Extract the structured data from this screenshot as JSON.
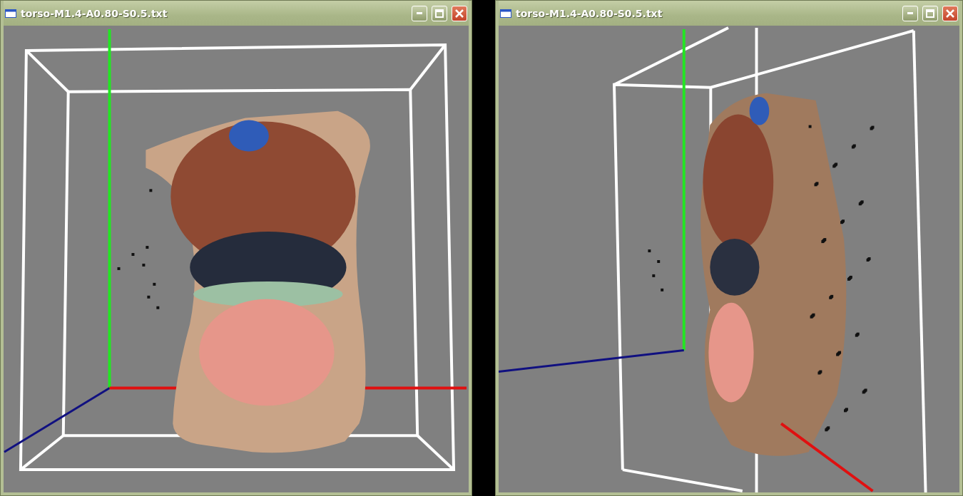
{
  "windows": [
    {
      "title": "torso-M1.4-A0.80-S0.5.txt",
      "kind": "front"
    },
    {
      "title": "torso-M1.4-A0.80-S0.5.txt",
      "kind": "side"
    }
  ]
}
